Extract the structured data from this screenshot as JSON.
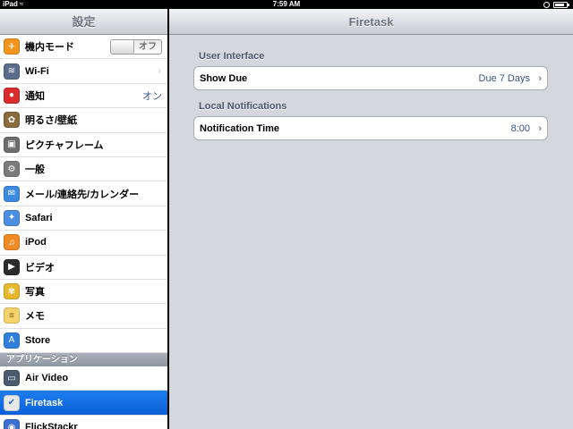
{
  "status": {
    "device": "iPad",
    "time": "7:59 AM",
    "battery_level": 0.85
  },
  "master": {
    "title": "設定",
    "items": [
      {
        "label": "機内モード",
        "icon": "airplane-icon",
        "color": "#f0961e",
        "glyph": "✈",
        "toggle": "オフ"
      },
      {
        "label": "Wi-Fi",
        "icon": "wifi-icon",
        "color": "#5b6d8a",
        "glyph": "≋",
        "chevron": "›"
      },
      {
        "label": "通知",
        "icon": "notifications-icon",
        "color": "#d92c2c",
        "glyph": "●",
        "value": "オン"
      },
      {
        "label": "明るさ/壁紙",
        "icon": "brightness-icon",
        "color": "#8a6b3c",
        "glyph": "✿"
      },
      {
        "label": "ピクチャフレーム",
        "icon": "picture-frame-icon",
        "color": "#6e6e6e",
        "glyph": "▣"
      },
      {
        "label": "一般",
        "icon": "gear-icon",
        "color": "#7b7b7b",
        "glyph": "⚙"
      },
      {
        "label": "メール/連絡先/カレンダー",
        "icon": "mail-icon",
        "color": "#3d8be0",
        "glyph": "✉"
      },
      {
        "label": "Safari",
        "icon": "safari-icon",
        "color": "#4b8fe3",
        "glyph": "✦"
      },
      {
        "label": "iPod",
        "icon": "ipod-icon",
        "color": "#f08a24",
        "glyph": "♫"
      },
      {
        "label": "ビデオ",
        "icon": "video-icon",
        "color": "#2c2c2c",
        "glyph": "▶"
      },
      {
        "label": "写真",
        "icon": "photos-icon",
        "color": "#e6b82e",
        "glyph": "✾"
      },
      {
        "label": "メモ",
        "icon": "notes-icon",
        "color": "#f3d36c",
        "glyph": "≡"
      },
      {
        "label": "Store",
        "icon": "store-icon",
        "color": "#2f7fdc",
        "glyph": "A"
      }
    ],
    "apps_header": "アプリケーション",
    "apps": [
      {
        "label": "Air Video",
        "icon": "air-video-icon",
        "color": "#4a5b6e",
        "glyph": "▭"
      },
      {
        "label": "Firetask",
        "icon": "firetask-icon",
        "color": "#e8e8e8",
        "glyph": "✔",
        "selected": true
      },
      {
        "label": "FlickStackr",
        "icon": "flickstackr-icon",
        "color": "#3b6fd0",
        "glyph": "◉"
      }
    ]
  },
  "detail": {
    "title": "Firetask",
    "groups": [
      {
        "header": "User Interface",
        "row": {
          "label": "Show Due",
          "value": "Due 7 Days"
        }
      },
      {
        "header": "Local Notifications",
        "row": {
          "label": "Notification Time",
          "value": "8:00"
        }
      }
    ]
  }
}
